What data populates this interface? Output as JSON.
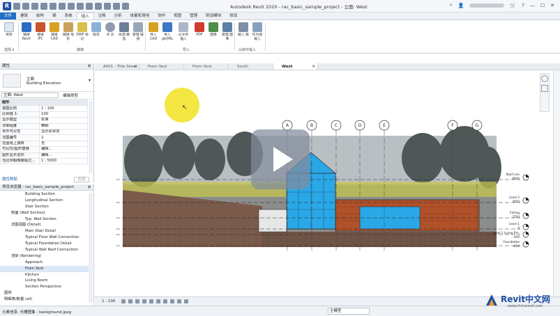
{
  "app": {
    "title": "Autodesk Revit 2020 - rac_basic_sample_project - 立面: West",
    "user_menu": "▾"
  },
  "ribbon_tabs": [
    "文件",
    "建筑",
    "结构",
    "钢",
    "系统",
    "插入",
    "注释",
    "分析",
    "体量和场地",
    "协作",
    "视图",
    "管理",
    "附加模块",
    "修改"
  ],
  "ribbon": {
    "buttons": [
      {
        "label": "修改"
      },
      {
        "label": "链接 Revit"
      },
      {
        "label": "链接 IFC"
      },
      {
        "label": "链接 CAD"
      },
      {
        "label": "链接 地形"
      },
      {
        "label": "DWF 标记"
      },
      {
        "label": "贴花"
      },
      {
        "label": "点 云"
      },
      {
        "label": "协调 模型"
      },
      {
        "label": "管理 链接"
      },
      {
        "label": "导入 CAD"
      },
      {
        "label": "导入 gbXML"
      },
      {
        "label": "从文件 插入"
      },
      {
        "label": "PDF"
      },
      {
        "label": "图像"
      },
      {
        "label": "管理 图像"
      },
      {
        "label": "载入 族"
      },
      {
        "label": "作为组 载入"
      }
    ],
    "panels": [
      "选择 ▾",
      "链接",
      "导入",
      "从库中载入"
    ]
  },
  "properties": {
    "header": "属性",
    "type_line1": "立面",
    "type_line2": "Building Elevation",
    "instance": "立面: West",
    "edit_type": "编辑类型",
    "rows": [
      {
        "k": "图形",
        "v": "",
        "group": true
      },
      {
        "k": "视图比例",
        "v": "1 : 100"
      },
      {
        "k": "比例值 1:",
        "v": "100"
      },
      {
        "k": "显示模型",
        "v": "标准"
      },
      {
        "k": "详细程度",
        "v": "精细"
      },
      {
        "k": "零件可见性",
        "v": "显示原状态"
      },
      {
        "k": "详图编号",
        "v": "2"
      },
      {
        "k": "在图纸上旋转",
        "v": "无"
      },
      {
        "k": "可见性/图形替换",
        "v": "编辑..."
      },
      {
        "k": "图形显示选项",
        "v": "编辑..."
      },
      {
        "k": "当比例粗略度超过...",
        "v": "1 : 5000"
      }
    ],
    "help": "属性帮助",
    "apply": "应用"
  },
  "browser": {
    "header": "项目浏览器 - rac_basic_sample_project",
    "items": [
      {
        "label": "Building Section",
        "level": 2
      },
      {
        "label": "Longitudinal Section",
        "level": 2
      },
      {
        "label": "Stair Section",
        "level": 2
      },
      {
        "label": "剖面 (Wall Section)",
        "level": 1
      },
      {
        "label": "Typ. Wall Section",
        "level": 2
      },
      {
        "label": "详图视图 (Detail)",
        "level": 1
      },
      {
        "label": "Main Stair Detail",
        "level": 2
      },
      {
        "label": "Typical Floor Wall Connection",
        "level": 2
      },
      {
        "label": "Typical Foundation Detail",
        "level": 2
      },
      {
        "label": "Typical Wall Roof Connection",
        "level": 2
      },
      {
        "label": "渲染 (Rendering)",
        "level": 1
      },
      {
        "label": "Approach",
        "level": 2
      },
      {
        "label": "From Yard",
        "level": 2,
        "selected": true
      },
      {
        "label": "Kitchen",
        "level": 2
      },
      {
        "label": "Living Room",
        "level": 2
      },
      {
        "label": "Section Perspective",
        "level": 2
      },
      {
        "label": "图例",
        "level": 0
      },
      {
        "label": "明细表/数量 (all)",
        "level": 0
      }
    ]
  },
  "doc_tabs": [
    {
      "label": "A001 - Title Sheet"
    },
    {
      "label": "From Yard"
    },
    {
      "label": "From Yard"
    },
    {
      "label": "South"
    },
    {
      "label": "West",
      "active": true
    }
  ],
  "grid_labels": [
    "A",
    "B",
    "C",
    "D",
    "E",
    "F",
    "G"
  ],
  "levels": [
    {
      "name": "Roof Line",
      "value": "6600"
    },
    {
      "name": "Level 2",
      "value": "3000"
    },
    {
      "name": "Ceiling",
      "value": "2700"
    },
    {
      "name": "Level 1",
      "value": "0"
    },
    {
      "name": "Level 1 Living Rm.",
      "value": "-450"
    },
    {
      "name": "Foundation",
      "value": "-850"
    }
  ],
  "viewbar": {
    "scale": "1 : 100"
  },
  "status": {
    "message": "元素信息: 光栅图像 : background.jpeg",
    "model": "主模型"
  },
  "watermark": {
    "brand": "Revit中文网",
    "url": "www.chinarevit.com"
  },
  "colors": {
    "accent": "#1f6fc5",
    "glass": "#2aa7e6",
    "wood": "#b0512a",
    "cursor": "#f3e63a"
  }
}
